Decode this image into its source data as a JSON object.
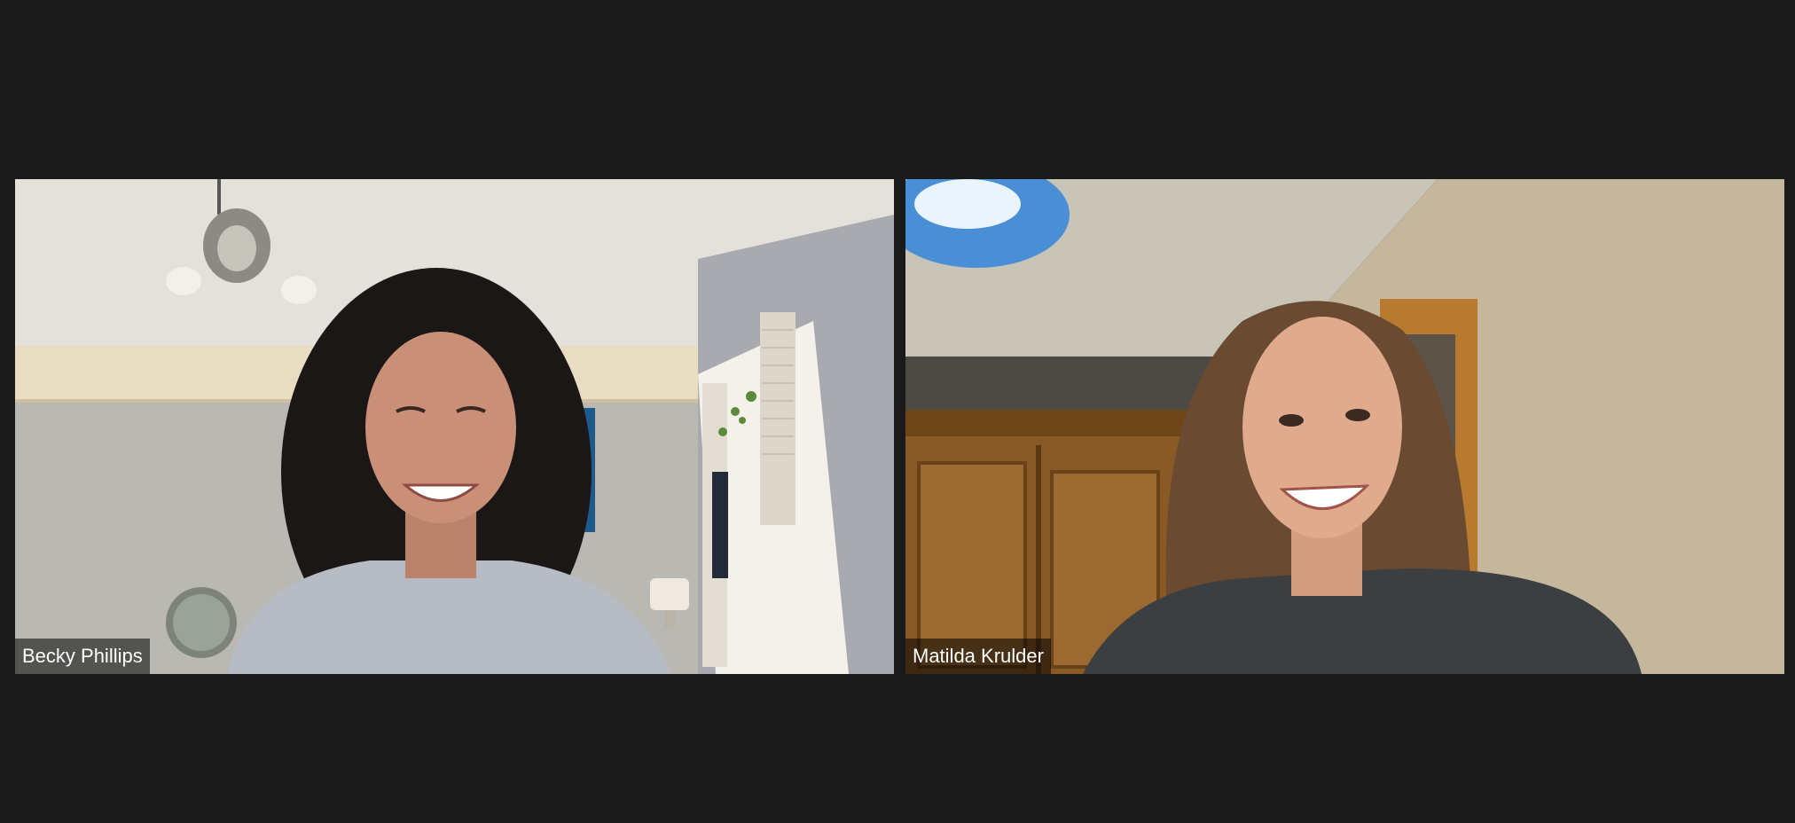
{
  "participants": [
    {
      "name": "Becky Phillips"
    },
    {
      "name": "Matilda Krulder"
    }
  ],
  "colors": {
    "background": "#1a1a1a",
    "label_background": "rgba(0,0,0,0.55)",
    "label_text": "#ffffff"
  }
}
